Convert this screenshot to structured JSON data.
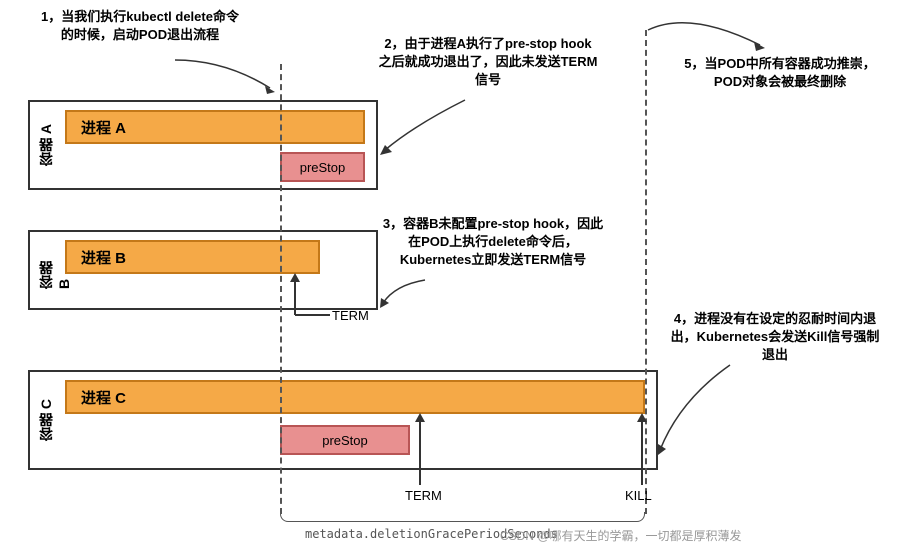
{
  "annotations": {
    "n1": "1，当我们执行kubectl delete命令的时候，启动POD退出流程",
    "n2": "2，由于进程A执行了pre-stop hook之后就成功退出了，因此未发送TERM信号",
    "n3": "3，容器B未配置pre-stop hook，因此在POD上执行delete命令后，Kubernetes立即发送TERM信号",
    "n4": "4，进程没有在设定的忍耐时间内退出，Kubernetes会发送Kill信号强制退出",
    "n5": "5，当POD中所有容器成功推崇，POD对象会被最终删除"
  },
  "containers": {
    "a": {
      "label": "容器 A",
      "process": "进程 A",
      "prestop": "preStop"
    },
    "b": {
      "label": "容器 B",
      "process": "进程 B"
    },
    "c": {
      "label": "容器 C",
      "process": "进程 C",
      "prestop": "preStop"
    }
  },
  "signals": {
    "term": "TERM",
    "kill": "KILL"
  },
  "meta": "metadata.deletionGracePeriodSeconds",
  "watermark": "CSDN @哪有天生的学霸，一切都是厚积薄发"
}
